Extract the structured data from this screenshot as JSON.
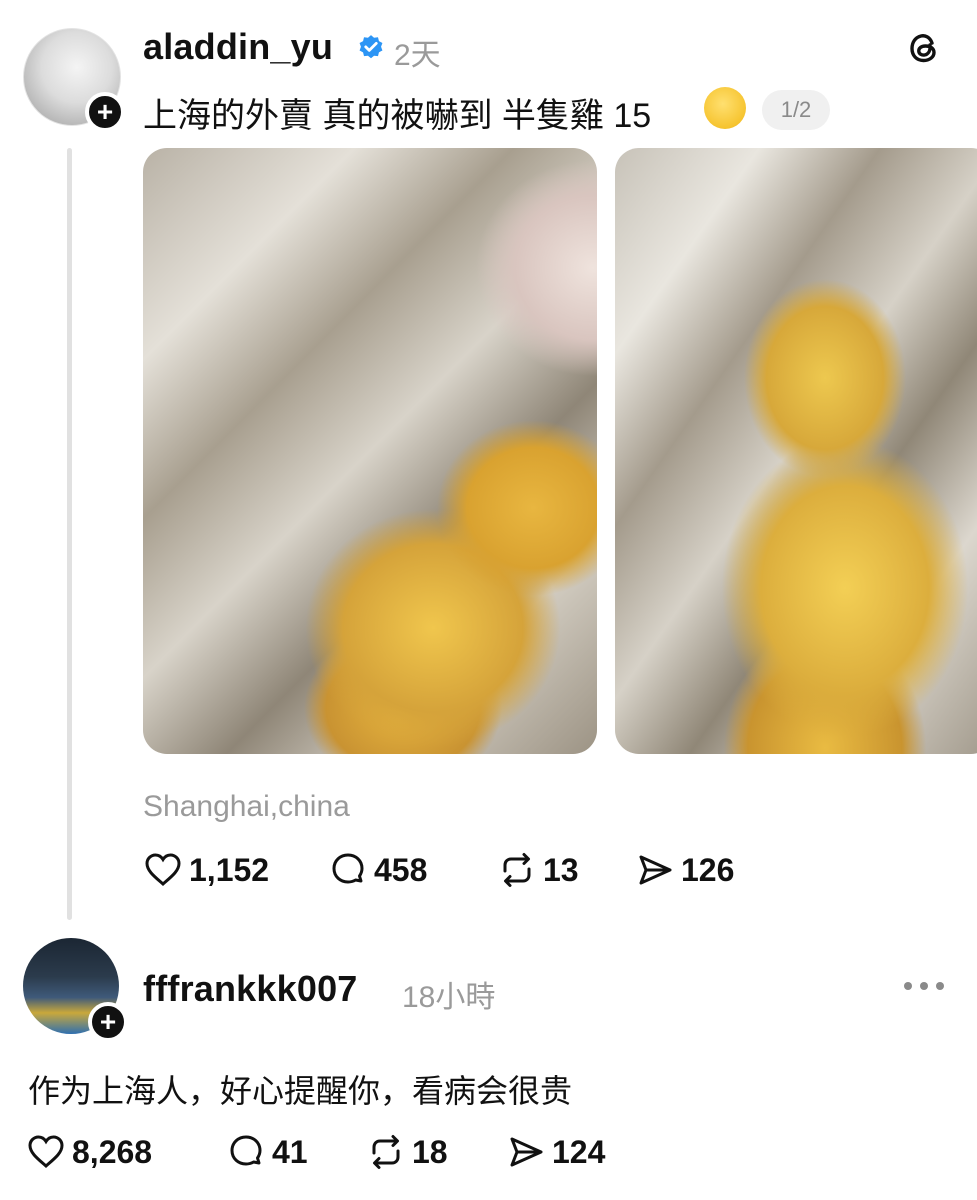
{
  "post": {
    "username": "aladdin_yu",
    "time": "2天",
    "text": "上海的外賣 真的被嚇到 半隻雞 15",
    "emoji": "melting-face-emoji",
    "pager": "1/2",
    "location": "Shanghai,china",
    "likes": "1,152",
    "replies": "458",
    "reposts": "13",
    "shares": "126",
    "photos": [
      "chicken-photo-1",
      "chicken-photo-2"
    ]
  },
  "reply": {
    "username": "fffrankkk007",
    "time": "18小時",
    "text": "作为上海人，好心提醒你，看病会很贵",
    "likes": "8,268",
    "replies": "41",
    "reposts": "18",
    "shares": "124"
  },
  "icons": {
    "verified": "verified-badge-icon",
    "app": "threads-logo-icon",
    "more": "more-icon",
    "like": "heart-icon",
    "reply": "comment-icon",
    "repost": "repost-icon",
    "share": "share-icon",
    "follow": "plus-icon"
  },
  "colors": {
    "verified": "#2c95f5",
    "secondary_text": "#9a9a9a",
    "thread_line": "#e1e1e1"
  }
}
